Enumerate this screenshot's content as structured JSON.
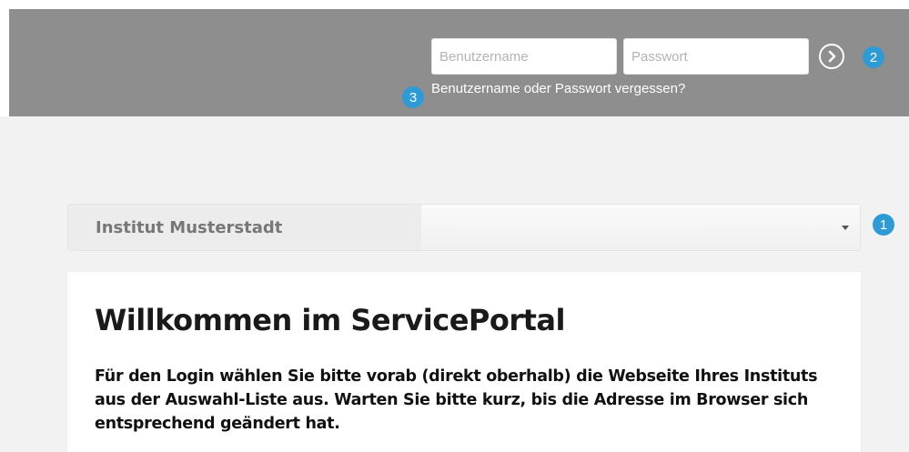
{
  "header": {
    "username_placeholder": "Benutzername",
    "password_placeholder": "Passwort",
    "submit_icon": "chevron-right-circle-icon",
    "forgot_link": "Benutzername oder Passwort vergessen?"
  },
  "badges": {
    "one": "1",
    "two": "2",
    "three": "3"
  },
  "institute_select": {
    "selected": "Institut Musterstadt",
    "icon": "caret-down-icon"
  },
  "welcome": {
    "title": "Willkommen im ServicePortal",
    "text": "Für den Login wählen Sie bitte vorab (direkt oberhalb) die Webseite Ihres Instituts aus der Auswahl-Liste aus. Warten Sie bitte kurz, bis die Adresse im Browser sich entsprechend geändert hat."
  },
  "colors": {
    "header_bg": "#8e8e8e",
    "badge_blue": "#2e9bd6",
    "page_bg": "#f2f2f2"
  }
}
